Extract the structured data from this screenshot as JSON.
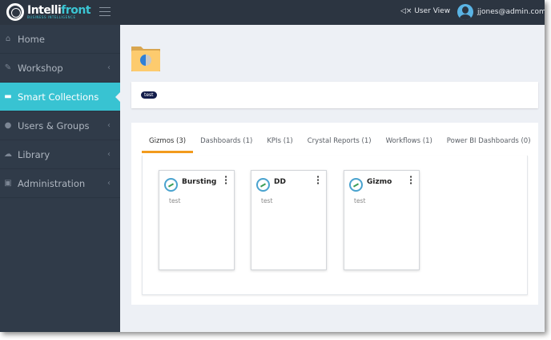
{
  "header": {
    "logo_text": "Intellifront",
    "logo_subtitle": "BUSINESS INTELLIGENCE",
    "user_view": "User View",
    "user_email": "jjones@admin.com"
  },
  "sidebar": {
    "items": [
      {
        "label": "Home",
        "icon": "home-icon",
        "chevron": false
      },
      {
        "label": "Workshop",
        "icon": "wrench-icon",
        "chevron": true
      },
      {
        "label": "Smart Collections",
        "icon": "folder-icon",
        "chevron": false,
        "active": true
      },
      {
        "label": "Users & Groups",
        "icon": "users-icon",
        "chevron": true
      },
      {
        "label": "Library",
        "icon": "cloud-icon",
        "chevron": true
      },
      {
        "label": "Administration",
        "icon": "briefcase-icon",
        "chevron": true
      }
    ]
  },
  "collection": {
    "tag": "test"
  },
  "tabs": [
    {
      "label": "Gizmos (3)",
      "active": true
    },
    {
      "label": "Dashboards (1)"
    },
    {
      "label": "KPIs (1)"
    },
    {
      "label": "Crystal Reports (1)"
    },
    {
      "label": "Workflows (1)"
    },
    {
      "label": "Power BI Dashboards (0)"
    }
  ],
  "cards": [
    {
      "name": "Bursting",
      "description": "test"
    },
    {
      "name": "DD",
      "description": "test"
    },
    {
      "name": "Gizmo",
      "description": "test"
    }
  ],
  "colors": {
    "accent": "#38c3d2",
    "tab_underline": "#f29b1d",
    "header": "#2c3541",
    "sidebar": "#303b49",
    "tag": "#121c4a"
  }
}
